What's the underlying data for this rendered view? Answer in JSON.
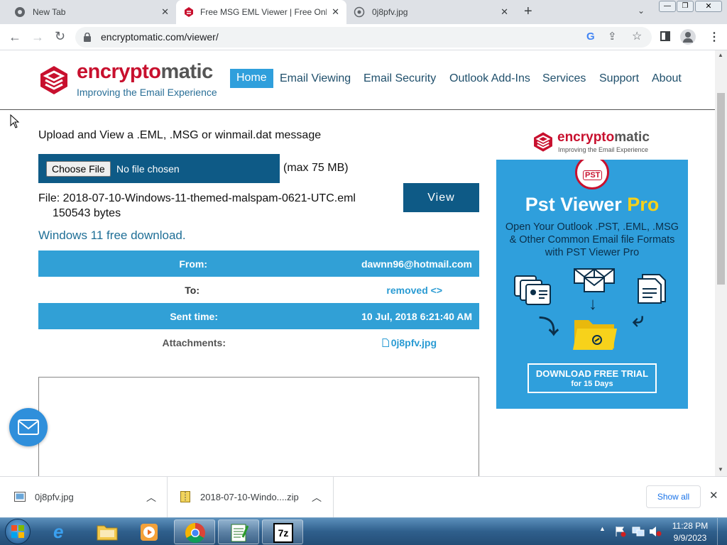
{
  "tabs": [
    {
      "title": "New Tab"
    },
    {
      "title": "Free MSG EML Viewer | Free Onli"
    },
    {
      "title": "0j8pfv.jpg"
    }
  ],
  "address": {
    "url": "encryptomatic.com/viewer/"
  },
  "site": {
    "logo_main_1": "encrypto",
    "logo_main_2": "matic",
    "logo_tagline": "Improving the Email Experience",
    "nav": [
      "Home",
      "Email Viewing",
      "Email Security",
      "Outlook Add-Ins",
      "Services",
      "Support",
      "About"
    ]
  },
  "viewer": {
    "heading": "Upload and View a .EML, .MSG or winmail.dat message",
    "choose_file": "Choose File",
    "no_file": "No file chosen",
    "max": "(max 75 MB)",
    "file_line": "File: 2018-07-10-Windows-11-themed-malspam-0621-UTC.eml",
    "bytes": "150543 bytes",
    "view_button": "View",
    "subject_link": "Windows 11 free download.",
    "fields": [
      {
        "label": "From:",
        "value": "dawnn96@hotmail.com"
      },
      {
        "label": "To:",
        "value": "removed <>"
      },
      {
        "label": "Sent time:",
        "value": "10 Jul, 2018 6:21:40 AM"
      },
      {
        "label": "Attachments:",
        "value": "0j8pfv.jpg"
      }
    ]
  },
  "ad": {
    "logo_1": "encrypto",
    "logo_2": "matic",
    "tagline": "Improving the Email Experience",
    "badge": "PST",
    "title_1": "Pst Viewer ",
    "title_2": "Pro",
    "desc": "Open Your Outlook .PST, .EML, .MSG & Other Common Email file Formats with PST Viewer Pro",
    "cta_1": "DOWNLOAD FREE TRIAL",
    "cta_2": "for 15 Days"
  },
  "downloads": {
    "items": [
      {
        "name": "0j8pfv.jpg"
      },
      {
        "name": "2018-07-10-Windo....zip"
      }
    ],
    "show_all": "Show all"
  },
  "clock": {
    "time": "11:28 PM",
    "date": "9/9/2023"
  },
  "colors": {
    "brand_red": "#c8102e",
    "row_blue": "#31a0d6",
    "view_button": "#0e5a86",
    "ad_blue": "#2f9fdc"
  }
}
